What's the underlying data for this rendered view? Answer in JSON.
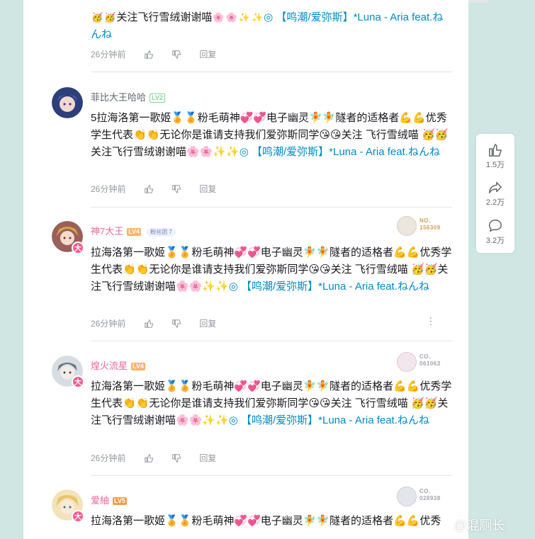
{
  "comments": [
    {
      "user": "",
      "level": "",
      "fans_badge": "",
      "card": "",
      "text_part1": "",
      "text_tail": "关注飞行雪绒谢谢喵",
      "link": "【鸣潮/爱弥斯】*Luna - Aria feat.ねんね",
      "time": "26分钟前",
      "reply": "回复"
    },
    {
      "user": "菲比大王哈哈",
      "level": "LV2",
      "fans_badge": "",
      "card": "",
      "text": "5拉海洛第一歌姬🏅🏅粉毛萌神💞💞电子幽灵🧚🧚隧者的适格者💪💪优秀学生代表👏👏无论你是谁请支持我们爱弥斯同学😘😘关注 飞行雪绒喵 🥳🥳关注飞行雪绒谢谢喵🌸🌸✨✨",
      "link": "【鸣潮/爱弥斯】*Luna - Aria feat.ねんね",
      "time": "26分钟前",
      "reply": "回复"
    },
    {
      "user": "神7大王",
      "level": "LV4",
      "fans_badge": "粉丝团 7",
      "card": "NO. 156309",
      "text": "拉海洛第一歌姬🏅🏅粉毛萌神💞💞电子幽灵🧚🧚隧者的适格者💪💪优秀学生代表👏👏无论你是谁请支持我们爱弥斯同学😘😘关注 飞行雪绒喵 🥳🥳关注飞行雪绒谢谢喵🌸🌸✨✨",
      "link": "【鸣潮/爱弥斯】*Luna - Aria feat.ねんね",
      "time": "26分钟前",
      "reply": "回复"
    },
    {
      "user": "煌火流星",
      "level": "LV4",
      "fans_badge": "",
      "card": "CO. 061063",
      "text": "拉海洛第一歌姬🏅🏅粉毛萌神💞💞电子幽灵🧚🧚隧者的适格者💪💪优秀学生代表👏👏无论你是谁请支持我们爱弥斯同学😘😘关注 飞行雪绒喵 🥳🥳关注飞行雪绒谢谢喵🌸🌸✨✨",
      "link": "【鸣潮/爱弥斯】*Luna - Aria feat.ねんね",
      "time": "26分钟前",
      "reply": "回复"
    },
    {
      "user": "爱紬",
      "level": "LV5",
      "fans_badge": "",
      "card": "CO. 028938",
      "text": "拉海洛第一歌姬🏅🏅粉毛萌神💞💞电子幽灵🧚🧚隧者的适格者💪💪优秀",
      "link": "",
      "time": "",
      "reply": ""
    }
  ],
  "avatar_badge": "大",
  "sidebar": {
    "like_count": "1.5万",
    "share_count": "2.2万",
    "comment_count": "3.2万"
  },
  "watermark": "@混厕长",
  "colors": {
    "page_bg": "#cfe6e2",
    "link": "#008ac5",
    "pink_name": "#e96799",
    "badge": "#f45a8d"
  }
}
